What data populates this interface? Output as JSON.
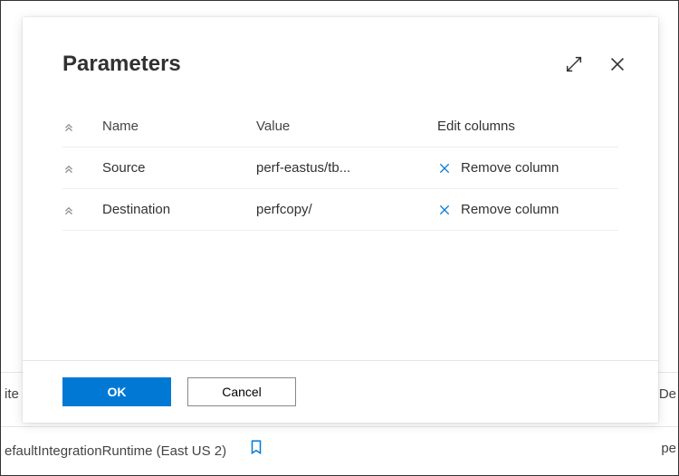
{
  "background": {
    "row1_left_fragment": "ite",
    "row1_right_fragment": "De",
    "row2_left": "efaultIntegrationRuntime (East US 2)",
    "row2_right_fragment": "pe"
  },
  "panel": {
    "title": "Parameters",
    "header": {
      "name_label": "Name",
      "value_label": "Value",
      "edit_label": "Edit columns"
    },
    "rows": [
      {
        "name": "Source",
        "value": "perf-eastus/tb...",
        "action_label": "Remove column"
      },
      {
        "name": "Destination",
        "value": "perfcopy/",
        "action_label": "Remove column"
      }
    ],
    "footer": {
      "ok_label": "OK",
      "cancel_label": "Cancel"
    }
  }
}
